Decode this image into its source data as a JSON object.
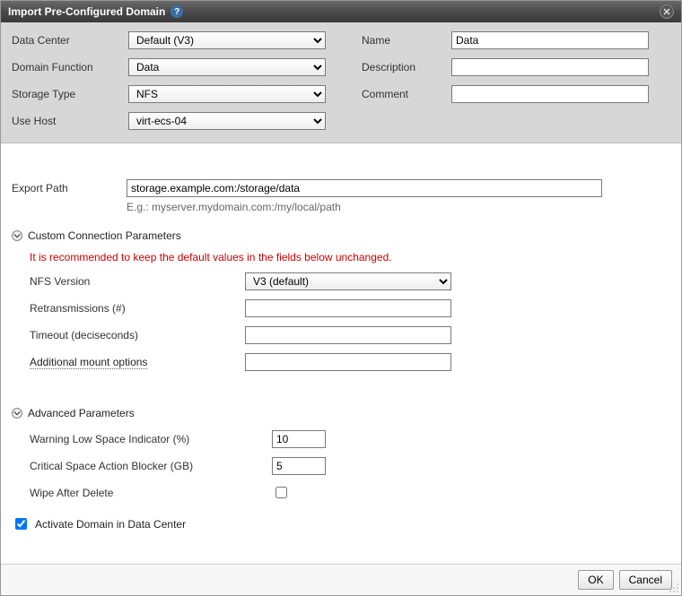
{
  "title": "Import Pre-Configured Domain",
  "top": {
    "dataCenter": {
      "label": "Data Center",
      "value": "Default (V3)"
    },
    "domainFunction": {
      "label": "Domain Function",
      "value": "Data"
    },
    "storageType": {
      "label": "Storage Type",
      "value": "NFS"
    },
    "useHost": {
      "label": "Use Host",
      "value": "virt-ecs-04"
    },
    "name": {
      "label": "Name",
      "value": "Data"
    },
    "description": {
      "label": "Description",
      "value": ""
    },
    "comment": {
      "label": "Comment",
      "value": ""
    }
  },
  "exportPath": {
    "label": "Export Path",
    "value": "storage.example.com:/storage/data",
    "hint": "E.g.: myserver.mydomain.com:/my/local/path"
  },
  "customConn": {
    "header": "Custom Connection Parameters",
    "warning": "It is recommended to keep the default values in the fields below unchanged.",
    "nfsVersion": {
      "label": "NFS Version",
      "value": "V3 (default)"
    },
    "retransmissions": {
      "label": "Retransmissions (#)",
      "value": ""
    },
    "timeout": {
      "label": "Timeout (deciseconds)",
      "value": ""
    },
    "mountOptions": {
      "label": "Additional mount options",
      "value": ""
    }
  },
  "advanced": {
    "header": "Advanced Parameters",
    "warningLowSpace": {
      "label": "Warning Low Space Indicator (%)",
      "value": "10"
    },
    "criticalBlocker": {
      "label": "Critical Space Action Blocker (GB)",
      "value": "5"
    },
    "wipeAfterDelete": {
      "label": "Wipe After Delete",
      "checked": false
    }
  },
  "activate": {
    "label": "Activate Domain in Data Center",
    "checked": true
  },
  "buttons": {
    "ok": "OK",
    "cancel": "Cancel"
  }
}
